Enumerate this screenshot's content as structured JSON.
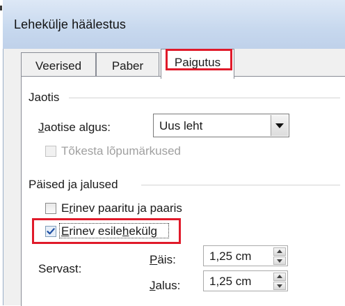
{
  "window": {
    "title": "Lehekülje häälestus"
  },
  "tabs": [
    {
      "label": "Veerised"
    },
    {
      "label": "Paber"
    },
    {
      "label": "Paigutus"
    }
  ],
  "section": {
    "title": "Jaotis",
    "start_label": "aotise algus:",
    "start_label_mnemonic": "J",
    "start_value": "Uus leht",
    "suppress_endnotes_label": "Tõkesta lõpumärkused",
    "suppress_endnotes_checked": false
  },
  "headers_footers": {
    "title": "Päised ja jalused",
    "odd_even_pre": "E",
    "odd_even_mnemonic": "r",
    "odd_even_post": "inev paaritu ja paaris",
    "odd_even_checked": false,
    "first_page_pre": "",
    "first_page_mnemonic": "E",
    "first_page_mid": "rinev esile",
    "first_page_mnemonic2": "h",
    "first_page_post": "ekülg",
    "first_page_checked": true,
    "from_edge_label": "Servast:",
    "header_label": "Päis:",
    "header_mnemonic": "P",
    "header_rest": "äis:",
    "header_value": "1,25 cm",
    "footer_mnemonic": "J",
    "footer_rest": "alus:",
    "footer_value": "1,25 cm"
  },
  "colors": {
    "highlight": "#e01a2a",
    "titlebar": "#c7d8ee",
    "check": "#1e4fa3"
  }
}
